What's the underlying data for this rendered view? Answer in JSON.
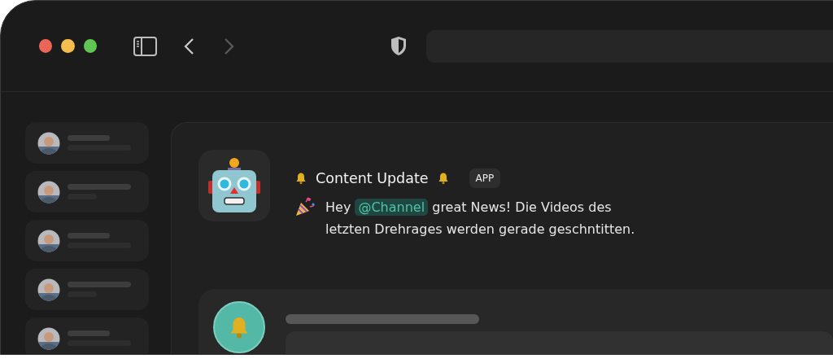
{
  "window": {
    "controls": [
      {
        "color": "#ec6559"
      },
      {
        "color": "#f4be4f"
      },
      {
        "color": "#5fc553"
      }
    ],
    "forward_disabled": true
  },
  "message": {
    "title": "Content Update",
    "badge": "APP",
    "body": [
      {
        "kind": "text",
        "text": "Hey"
      },
      {
        "kind": "mention",
        "text": "@Channel"
      },
      {
        "kind": "text",
        "text": "great News! Die Videos des letzten Drehrages werden gerade geschntitten."
      }
    ]
  }
}
